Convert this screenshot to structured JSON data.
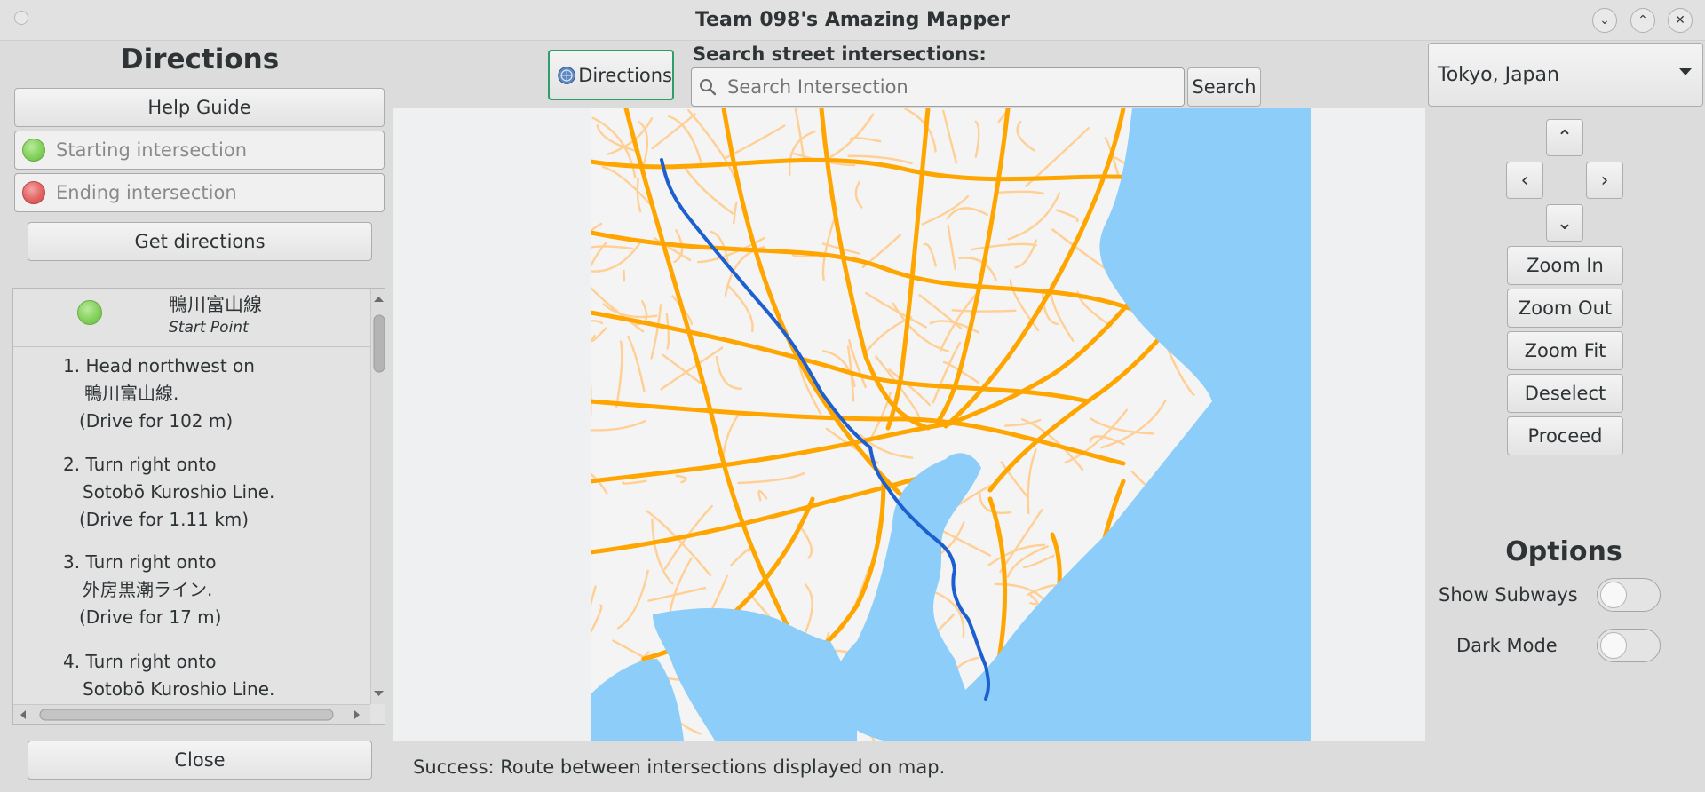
{
  "window": {
    "title": "Team 098's Amazing Mapper"
  },
  "left_panel": {
    "heading": "Directions",
    "help_button": "Help Guide",
    "start_placeholder": "Starting intersection",
    "end_placeholder": "Ending intersection",
    "get_directions_button": "Get directions",
    "close_button": "Close",
    "route_start": {
      "street": "鴨川富山線",
      "caption": "Start Point"
    },
    "steps": [
      {
        "line1": "1. Head northwest on",
        "line2": "鴨川富山線.",
        "line3": "(Drive for 102 m)"
      },
      {
        "line1": "2. Turn right onto",
        "line2": "Sotobō Kuroshio Line.",
        "line3": "(Drive for 1.11 km)"
      },
      {
        "line1": "3. Turn right onto",
        "line2": "外房黒潮ライン.",
        "line3": "(Drive for 17 m)"
      },
      {
        "line1": "4. Turn right onto",
        "line2": "Sotobō Kuroshio Line.",
        "line3": ""
      }
    ]
  },
  "toolbar": {
    "directions_toggle": "Directions",
    "search_label": "Search street intersections:",
    "search_placeholder": "Search Intersection",
    "search_button": "Search"
  },
  "map": {
    "land_color": "#f4f4f4",
    "water_color": "#8ccdf9",
    "road_color": "#ffa500",
    "minor_road_color": "#ffcf94",
    "route_color": "#1e5fd0"
  },
  "status": {
    "message": "Success: Route between intersections displayed on map."
  },
  "right_panel": {
    "city_selected": "Tokyo, Japan",
    "pan_up": "⌃",
    "pan_down": "⌄",
    "pan_left": "‹",
    "pan_right": "›",
    "buttons": {
      "zoom_in": "Zoom In",
      "zoom_out": "Zoom Out",
      "zoom_fit": "Zoom Fit",
      "deselect": "Deselect",
      "proceed": "Proceed"
    },
    "options_heading": "Options",
    "show_subways_label": "Show Subways",
    "dark_mode_label": "Dark Mode",
    "show_subways_on": false,
    "dark_mode_on": false
  }
}
